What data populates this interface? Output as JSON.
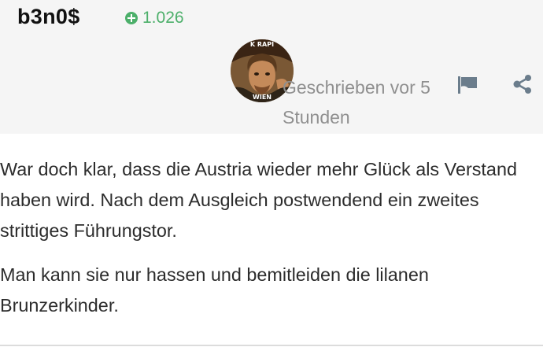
{
  "post": {
    "author": "b3n0$",
    "reputation": "1.026",
    "timestamp": "Geschrieben vor 5 Stunden",
    "avatar_caption_top": "K RAPI",
    "avatar_caption_bottom": "WIEN",
    "paragraphs": [
      "War doch klar, dass die Austria wieder mehr Glück als Verstand haben wird. Nach dem Ausgleich postwendend ein zweites strittiges Führungstor.",
      "Man kann sie nur hassen und bemitleiden die lilanen Brunzerkinder."
    ]
  },
  "actions": {
    "flag_icon": "flag-icon",
    "share_icon": "share-icon"
  },
  "colors": {
    "header_bg": "#f5f5f5",
    "reputation_green": "#4caf6a",
    "meta_gray": "#8f8f8f",
    "action_icon": "#6b7d8c"
  }
}
